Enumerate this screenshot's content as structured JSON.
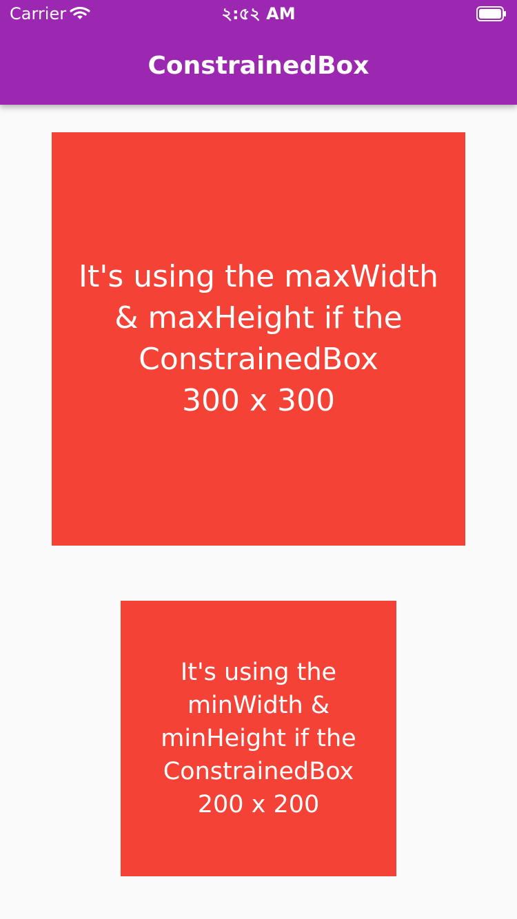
{
  "status_bar": {
    "carrier": "Carrier",
    "time": "২:৫২ AM",
    "wifi_icon": "wifi-icon",
    "battery_icon": "battery-icon"
  },
  "app_bar": {
    "title": "ConstrainedBox"
  },
  "boxes": [
    {
      "text": "It's using the maxWidth\n& maxHeight if the\nConstrainedBox\n300 x 300"
    },
    {
      "text": "It's using the\nminWidth &\nminHeight if the\nConstrainedBox\n200 x 200"
    }
  ],
  "colors": {
    "app_bar": "#9c27b0",
    "box": "#f44336",
    "background": "#fafafa",
    "text": "#ffffff"
  }
}
